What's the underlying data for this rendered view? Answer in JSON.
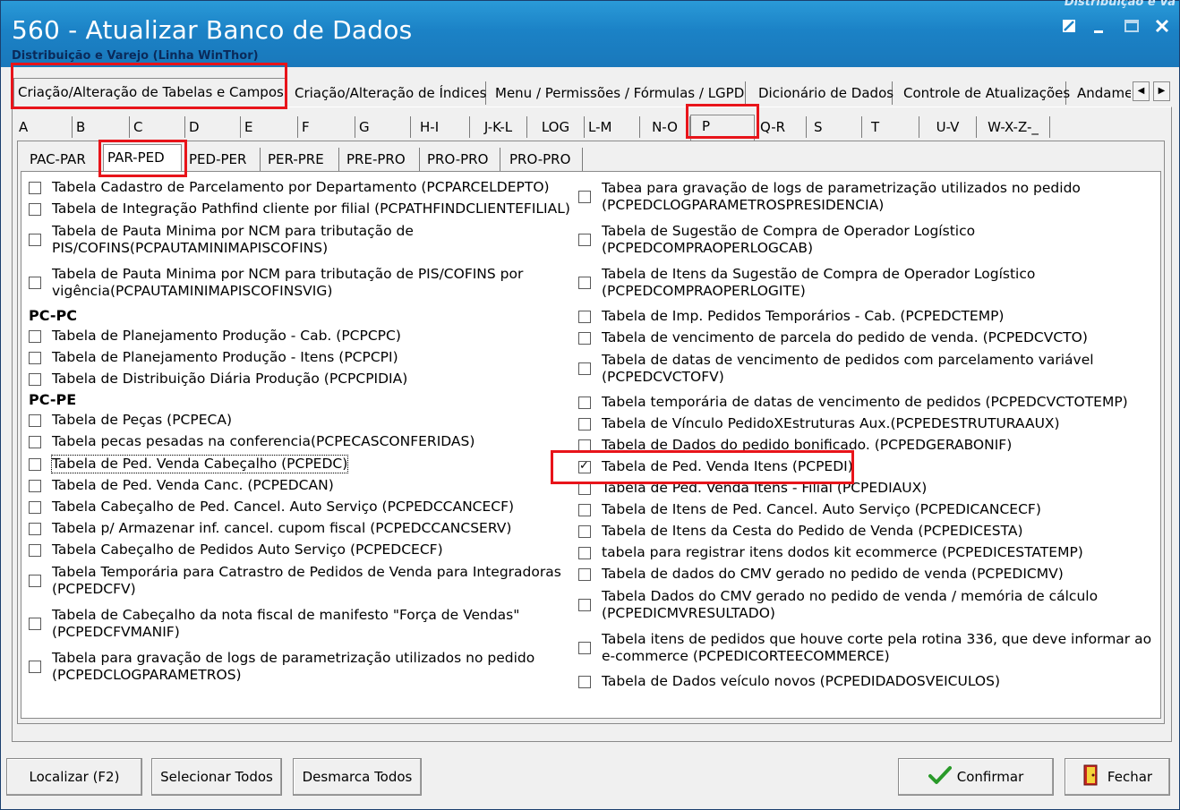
{
  "window": {
    "title": "560 - Atualizar Banco de Dados",
    "subtitle": "Distribuição e Varejo (Linha WinThor)",
    "top_right": "Distribuição e Va",
    "controls": [
      "restore-icon",
      "minimize-icon",
      "maximize-icon",
      "close-icon"
    ]
  },
  "main_tabs": [
    {
      "label": "Criação/Alteração de Tabelas e Campos"
    },
    {
      "label": "Criação/Alteração de Índices"
    },
    {
      "label": "Menu / Permissões / Fórmulas / LGPD"
    },
    {
      "label": "Dicionário de Dados"
    },
    {
      "label": "Controle de Atualizações"
    },
    {
      "label": "Andame"
    }
  ],
  "letter_tabs": [
    {
      "label": "A"
    },
    {
      "label": "B"
    },
    {
      "label": "C"
    },
    {
      "label": "D"
    },
    {
      "label": "E"
    },
    {
      "label": "F"
    },
    {
      "label": "G"
    },
    {
      "label": "H-I"
    },
    {
      "label": "J-K-L"
    },
    {
      "label": "LOG"
    },
    {
      "label": "L-M"
    },
    {
      "label": "N-O"
    },
    {
      "label": "P"
    },
    {
      "label": "Q-R"
    },
    {
      "label": "S"
    },
    {
      "label": "T"
    },
    {
      "label": "U-V"
    },
    {
      "label": "W-X-Z-_"
    }
  ],
  "sub_tabs": [
    {
      "label": "PAC-PAR"
    },
    {
      "label": "PAR-PED"
    },
    {
      "label": "PED-PER"
    },
    {
      "label": "PER-PRE"
    },
    {
      "label": "PRE-PRO"
    },
    {
      "label": "PRO-PRO"
    },
    {
      "label": "PRO-PRO"
    }
  ],
  "left_column": {
    "items": [
      {
        "label": "Tabela Cadastro de Parcelamento por Departamento (PCPARCELDEPTO)",
        "checked": false
      },
      {
        "label": "Tabela de Integração Pathfind cliente por filial (PCPATHFINDCLIENTEFILIAL)",
        "checked": false
      },
      {
        "label": "Tabela de Pauta Minima por NCM para tributação de",
        "label2": "PIS/COFINS(PCPAUTAMINIMAPISCOFINS)",
        "checked": false
      },
      {
        "label": "Tabela de Pauta Minima por NCM para tributação de PIS/COFINS por",
        "label2": "vigência(PCPAUTAMINIMAPISCOFINSVIG)",
        "checked": false
      }
    ],
    "section_pcpc": "PC-PC",
    "pcpc_items": [
      {
        "label": "Tabela de Planejamento Produção - Cab. (PCPCPC)",
        "checked": false
      },
      {
        "label": "Tabela de Planejamento Produção - Itens (PCPCPI)",
        "checked": false
      },
      {
        "label": "Tabela de Distribuição Diária Produção (PCPCPIDIA)",
        "checked": false
      }
    ],
    "section_pcpe": "PC-PE",
    "pcpe_items": [
      {
        "label": "Tabela de Peças (PCPECA)",
        "checked": false
      },
      {
        "label": "Tabela pecas pesadas na conferencia(PCPECASCONFERIDAS)",
        "checked": false
      },
      {
        "label": "Tabela de Ped. Venda Cabeçalho (PCPEDC)",
        "checked": false
      },
      {
        "label": "Tabela de Ped. Venda Canc. (PCPEDCAN)",
        "checked": false
      },
      {
        "label": "Tabela Cabeçalho de Ped. Cancel. Auto Serviço (PCPEDCCANCECF)",
        "checked": false
      },
      {
        "label": "Tabela p/ Armazenar inf. cancel. cupom fiscal (PCPEDCCANCSERV)",
        "checked": false
      },
      {
        "label": "Tabela Cabeçalho de Pedidos Auto Serviço (PCPEDCECF)",
        "checked": false
      },
      {
        "label": "Tabela Temporária para Catrastro de Pedidos de Venda para Integradoras",
        "label2": "(PCPEDCFV)",
        "checked": false
      },
      {
        "label": "Tabela de Cabeçalho da nota fiscal de manifesto \"Força de Vendas\"",
        "label2": "(PCPEDCFVMANIF)",
        "checked": false
      },
      {
        "label": "Tabela para gravação de logs de parametrização utilizados no pedido",
        "label2": "(PCPEDCLOGPARAMETROS)",
        "checked": false
      }
    ]
  },
  "right_column": {
    "items": [
      {
        "label": "Tabea para gravação de logs de parametrização utilizados no pedido",
        "label2": "(PCPEDCLOGPARAMETROSPRESIDENCIA)",
        "checked": false
      },
      {
        "label": "Tabela de Sugestão de Compra de Operador Logístico",
        "label2": "(PCPEDCOMPRAOPERLOGCAB)",
        "checked": false
      },
      {
        "label": "Tabela de Itens da Sugestão de Compra de Operador Logístico",
        "label2": "(PCPEDCOMPRAOPERLOGITE)",
        "checked": false
      },
      {
        "label": "Tabela de Imp. Pedidos Temporários - Cab. (PCPEDCTEMP)",
        "checked": false
      },
      {
        "label": "Tabela de vencimento de parcela do pedido de venda. (PCPEDCVCTO)",
        "checked": false
      },
      {
        "label": "Tabela de datas de vencimento de pedidos com parcelamento variável",
        "label2": "(PCPEDCVCTOFV)",
        "checked": false
      },
      {
        "label": "Tabela temporária de datas de vencimento de pedidos  (PCPEDCVCTOTEMP)",
        "checked": false
      },
      {
        "label": "Tabela de Vínculo PedidoXEstruturas Aux.(PCPEDESTRUTURAAUX)",
        "checked": false
      },
      {
        "label": "Tabela de Dados do pedido bonificado. (PCPEDGERABONIF)",
        "checked": false
      },
      {
        "label": "Tabela de Ped. Venda Itens (PCPEDI)",
        "checked": true
      },
      {
        "label": "Tabela de Ped. Venda Itens - Filial (PCPEDIAUX)",
        "checked": false
      },
      {
        "label": "Tabela de Itens de Ped. Cancel. Auto Serviço (PCPEDICANCECF)",
        "checked": false
      },
      {
        "label": "Tabela de Itens da Cesta do Pedido de Venda (PCPEDICESTA)",
        "checked": false
      },
      {
        "label": "tabela para registrar itens dodos kit ecommerce (PCPEDICESTATEMP)",
        "checked": false
      },
      {
        "label": "Tabela de dados do CMV gerado no pedido de venda (PCPEDICMV)",
        "checked": false
      },
      {
        "label": "Tabela Dados do CMV gerado no pedido de venda / memória de cálculo",
        "label2": "(PCPEDICMVRESULTADO)",
        "checked": false
      },
      {
        "label": "Tabela itens de pedidos que houve corte pela rotina 336, que deve informar ao",
        "label2": "e-commerce (PCPEDICORTEECOMMERCE)",
        "checked": false
      },
      {
        "label": "Tabela de Dados veículo novos (PCPEDIDADOSVEICULOS)",
        "checked": false
      }
    ]
  },
  "buttons": {
    "localizar": "Localizar (F2)",
    "selecionar": "Selecionar Todos",
    "desmarca": "Desmarca Todos",
    "confirmar": "Confirmar",
    "fechar": "Fechar"
  },
  "colors": {
    "title_bar": "#1b82c6",
    "highlight": "#e8141a",
    "check_green": "#2a9a2a"
  }
}
